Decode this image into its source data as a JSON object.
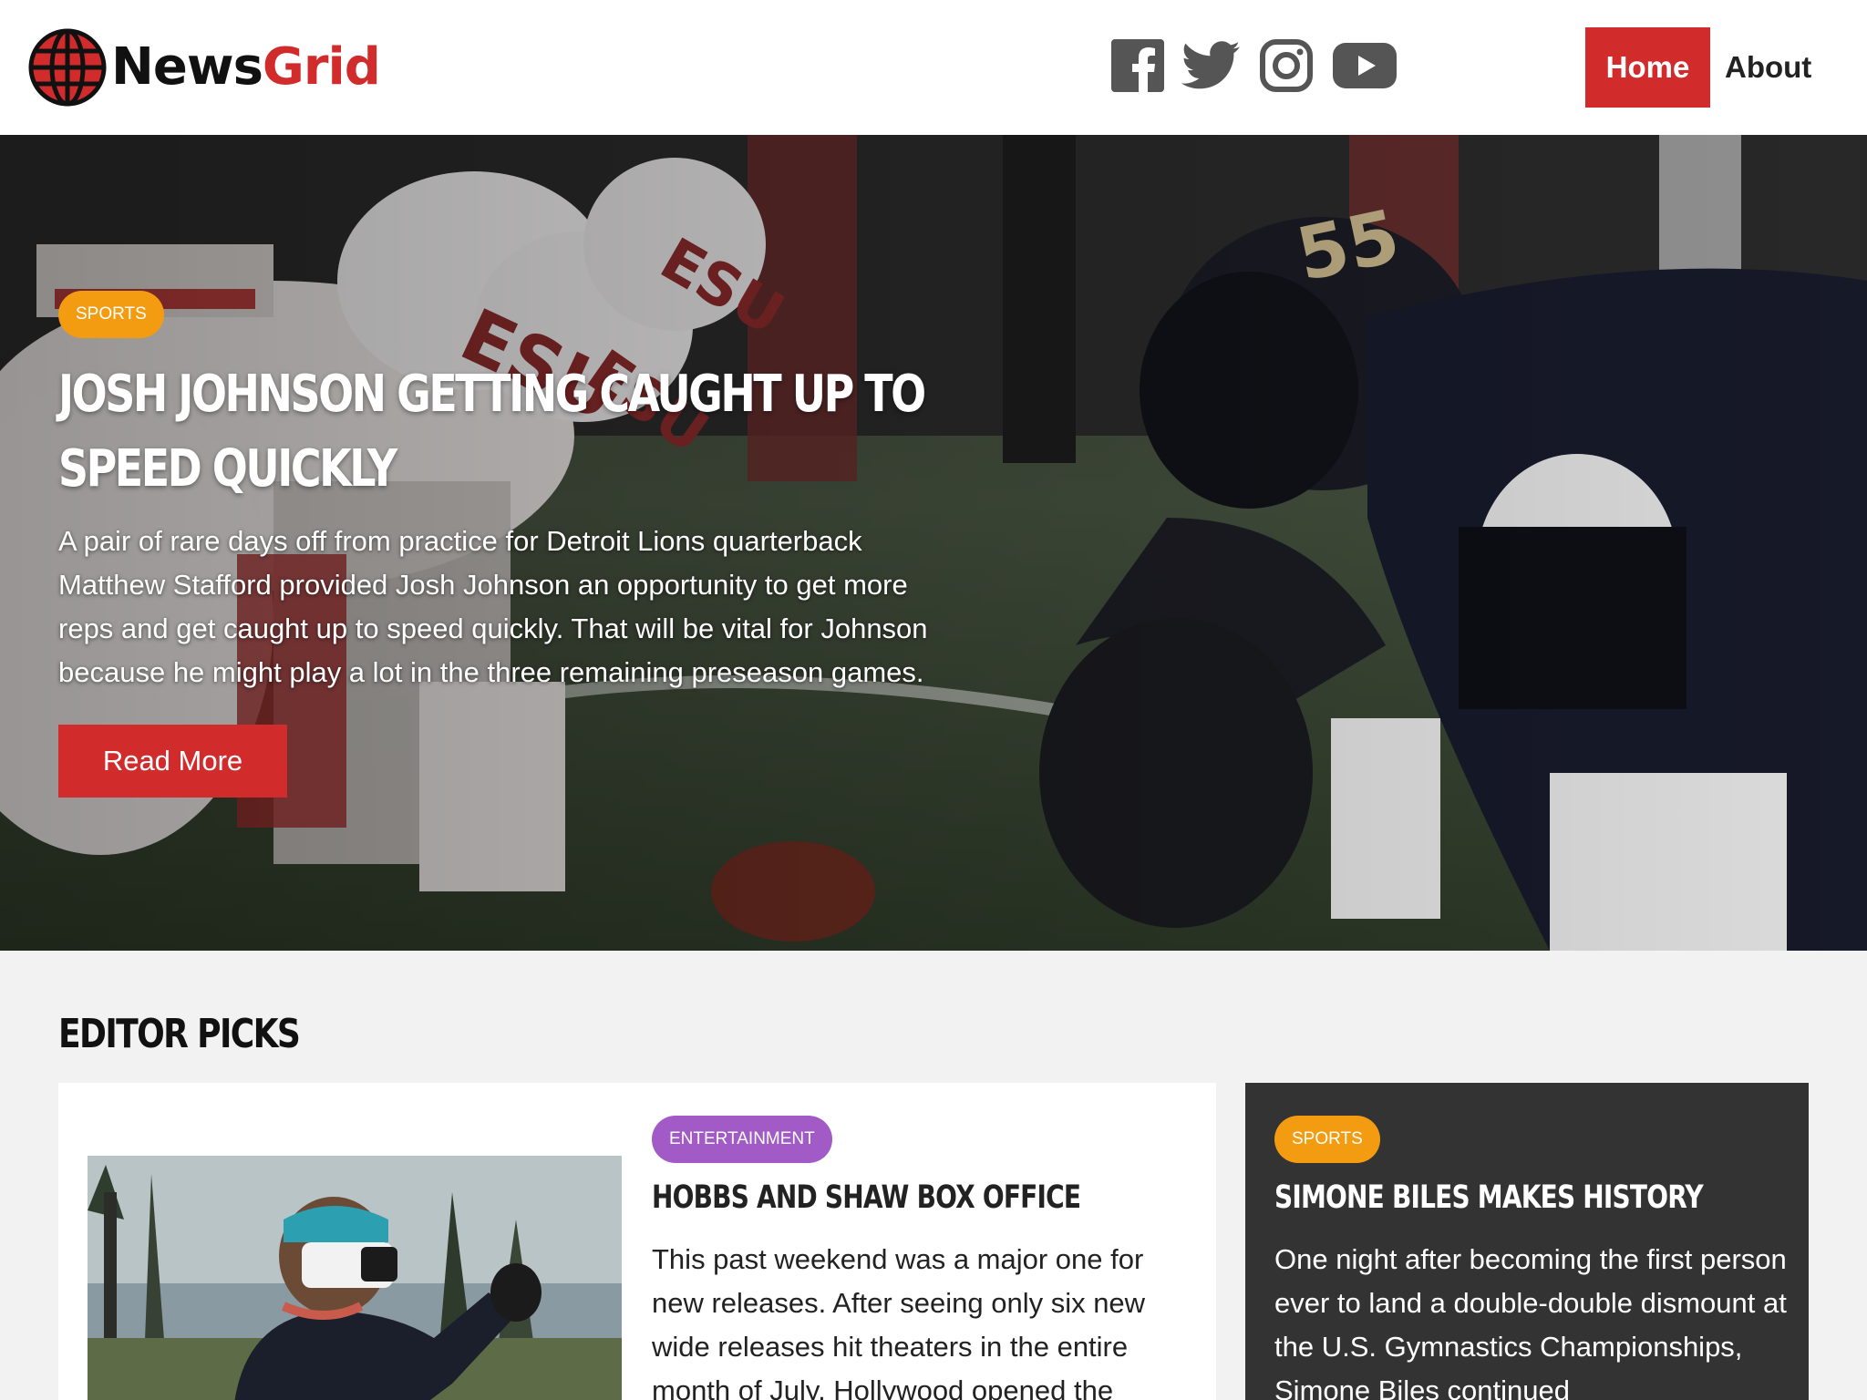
{
  "brand": {
    "name_part1": "News",
    "name_part2": "Grid",
    "accent": "#d12b2b"
  },
  "social": [
    {
      "icon": "facebook-icon"
    },
    {
      "icon": "twitter-icon"
    },
    {
      "icon": "instagram-icon"
    },
    {
      "icon": "youtube-icon"
    }
  ],
  "nav": {
    "home": "Home",
    "about": "About"
  },
  "hero": {
    "category": "SPORTS",
    "title_line1": "JOSH JOHNSON GETTING CAUGHT UP TO",
    "title_line2": "SPEED QUICKLY",
    "text": "A pair of rare days off from practice for Detroit Lions quarterback Matthew Stafford provided Josh Johnson an opportunity to get more reps and get caught up to speed quickly. That will be vital for Johnson because he might play a lot in the three remaining preseason games.",
    "button": "Read More"
  },
  "editor_picks": {
    "title": "EDITOR PICKS",
    "main": {
      "category": "ENTERTAINMENT",
      "title": "HOBBS AND SHAW BOX OFFICE",
      "text": "This past weekend was a major one for new releases. After seeing only six new wide releases hit theaters in the entire month of July, Hollywood opened the"
    },
    "side": {
      "category": "SPORTS",
      "title": "SIMONE BILES MAKES HISTORY",
      "text": "One night after becoming the first person ever to land a double-double dismount at the U.S. Gymnastics Championships, Simone Biles continued"
    }
  },
  "colors": {
    "sports_badge": "#f39c12",
    "entertainment_badge": "#a25bc6",
    "side_card_bg": "#333333"
  }
}
